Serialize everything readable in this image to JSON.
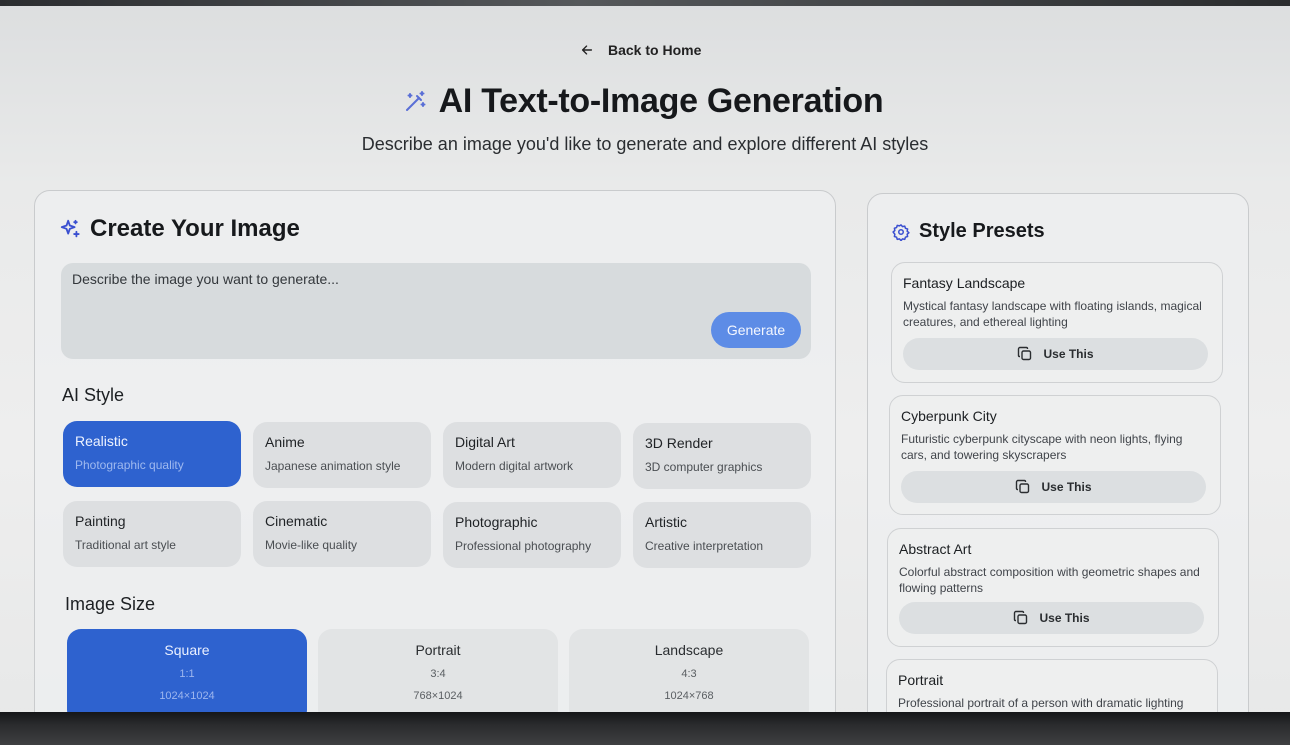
{
  "header": {
    "back_label": "Back to Home",
    "title": "AI Text-to-Image Generation",
    "subtitle": "Describe an image you'd like to generate and explore different AI styles"
  },
  "create": {
    "heading": "Create Your Image",
    "prompt_placeholder": "Describe the image you want to generate...",
    "prompt_value": "",
    "generate_label": "Generate",
    "style_label": "AI Style",
    "styles": [
      {
        "name": "Realistic",
        "desc": "Photographic quality",
        "selected": true
      },
      {
        "name": "Anime",
        "desc": "Japanese animation style",
        "selected": false
      },
      {
        "name": "Digital Art",
        "desc": "Modern digital artwork",
        "selected": false
      },
      {
        "name": "3D Render",
        "desc": "3D computer graphics",
        "selected": false
      },
      {
        "name": "Painting",
        "desc": "Traditional art style",
        "selected": false
      },
      {
        "name": "Cinematic",
        "desc": "Movie-like quality",
        "selected": false
      },
      {
        "name": "Photographic",
        "desc": "Professional photography",
        "selected": false
      },
      {
        "name": "Artistic",
        "desc": "Creative interpretation",
        "selected": false
      }
    ],
    "size_label": "Image Size",
    "sizes": [
      {
        "name": "Square",
        "ratio": "1:1",
        "dims": "1024×1024",
        "selected": true
      },
      {
        "name": "Portrait",
        "ratio": "3:4",
        "dims": "768×1024",
        "selected": false
      },
      {
        "name": "Landscape",
        "ratio": "4:3",
        "dims": "1024×768",
        "selected": false
      }
    ]
  },
  "presets": {
    "heading": "Style Presets",
    "use_label": "Use This",
    "items": [
      {
        "name": "Fantasy Landscape",
        "desc": "Mystical fantasy landscape with floating islands, magical creatures, and ethereal lighting"
      },
      {
        "name": "Cyberpunk City",
        "desc": "Futuristic cyberpunk cityscape with neon lights, flying cars, and towering skyscrapers"
      },
      {
        "name": "Abstract Art",
        "desc": "Colorful abstract composition with geometric shapes and flowing patterns"
      },
      {
        "name": "Portrait",
        "desc": "Professional portrait of a person with dramatic lighting"
      }
    ]
  },
  "colors": {
    "accent": "#2e62cf",
    "generate_button": "#5d8ce6"
  }
}
